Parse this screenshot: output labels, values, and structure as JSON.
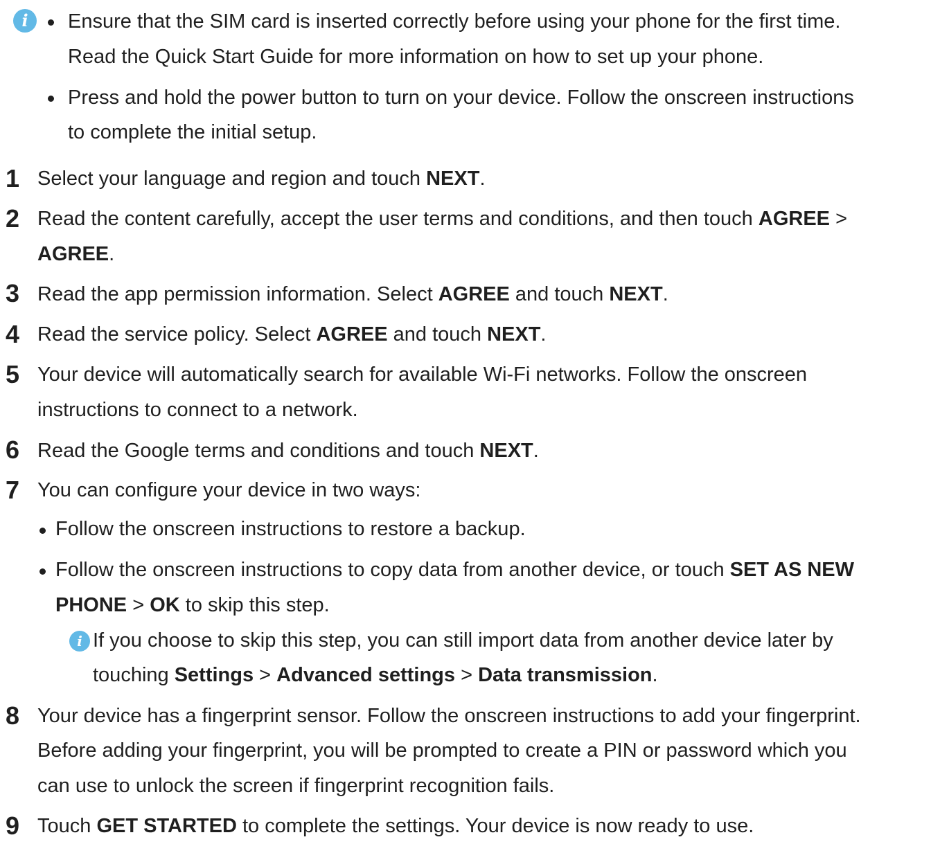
{
  "notes": {
    "intro": {
      "bullets": [
        {
          "lines": [
            "Ensure that the SIM card is inserted correctly before using your phone for the first time.",
            "Read the Quick Start Guide for more information on how to set up your phone."
          ]
        },
        {
          "lines": [
            "Press and hold the power button to turn on your device. Follow the onscreen instructions",
            "to complete the initial setup."
          ]
        }
      ]
    },
    "skip_note": {
      "line1": "If you choose to skip this step, you can still import data from another device later by",
      "line2_prefix": "touching ",
      "settings": "Settings",
      "sep1": " > ",
      "advanced": "Advanced settings",
      "sep2": " > ",
      "data_transmission": "Data transmission",
      "end": "."
    }
  },
  "steps": [
    {
      "num": "1",
      "prefix": "Select your language and region and touch ",
      "bold1": "NEXT",
      "suffix": "."
    },
    {
      "num": "2",
      "prefix": "Read the content carefully, accept the user terms and conditions, and then touch ",
      "bold1": "AGREE",
      "sep": " >",
      "bold2": "AGREE",
      "suffix": "."
    },
    {
      "num": "3",
      "prefix": "Read the app permission information. Select ",
      "bold1": "AGREE",
      "mid": " and touch ",
      "bold2": "NEXT",
      "suffix": "."
    },
    {
      "num": "4",
      "prefix": "Read the service policy. Select ",
      "bold1": "AGREE",
      "mid": " and touch ",
      "bold2": "NEXT",
      "suffix": "."
    },
    {
      "num": "5",
      "line1": "Your device will automatically search for available Wi-Fi networks. Follow the onscreen",
      "line2": "instructions to connect to a network."
    },
    {
      "num": "6",
      "prefix": "Read the Google terms and conditions and touch ",
      "bold1": "NEXT",
      "suffix": "."
    },
    {
      "num": "7",
      "text": "You can configure your device in two ways:",
      "sub": [
        {
          "text": "Follow the onscreen instructions to restore a backup."
        },
        {
          "prefix": "Follow the onscreen instructions to copy data from another device, or touch ",
          "bold1": "SET AS NEW",
          "bold1b": "PHONE",
          "sep": " > ",
          "bold2": "OK",
          "suffix": " to skip this step."
        }
      ]
    },
    {
      "num": "8",
      "line1": "Your device has a fingerprint sensor. Follow the onscreen instructions to add your fingerprint.",
      "line2": "Before adding your fingerprint, you will be prompted to create a PIN or password which you",
      "line3": "can use to unlock the screen if fingerprint recognition fails."
    },
    {
      "num": "9",
      "prefix": "Touch ",
      "bold1": "GET STARTED",
      "suffix": " to complete the settings. Your device is now ready to use."
    }
  ],
  "icons": {
    "info_glyph": "i"
  },
  "colors": {
    "info_icon": "#62b9e6",
    "text": "#1f1f1f"
  }
}
